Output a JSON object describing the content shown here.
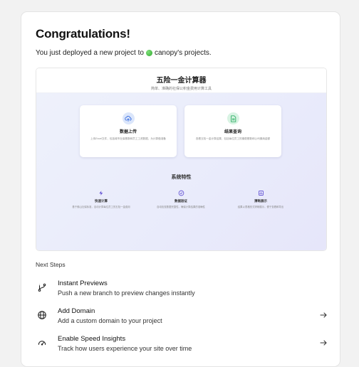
{
  "header": {
    "title": "Congratulations!",
    "subtitle_prefix": "You just deployed a new project to",
    "project_owner": "canopy's projects."
  },
  "preview": {
    "title": "五险一金计算器",
    "subtitle": "简单、准确的社保公积金费用计算工具",
    "features": [
      {
        "icon": "upload-cloud-icon",
        "title": "数据上传",
        "desc": "上传Excel文件，包括城市社保基数和员工工资数据，为计算做准备"
      },
      {
        "icon": "file-document-icon",
        "title": "结果查询",
        "desc": "查看五险一金计算结果，包括每位员工的缴费基数和公司缴纳金额"
      }
    ],
    "section_title": "系统特性",
    "traits": [
      {
        "icon": "lightning-icon",
        "title": "快速计算",
        "desc": "基于佛山社保标准，自动计算每位员工的五险一金费用"
      },
      {
        "icon": "check-circle-icon",
        "title": "数据验证",
        "desc": "自动检查数据完整性，确保计算结果的准确性"
      },
      {
        "icon": "chart-icon",
        "title": "清晰展示",
        "desc": "结果以表格形式清晰展示，便于查看和导出"
      }
    ]
  },
  "next_steps": {
    "label": "Next Steps",
    "items": [
      {
        "icon": "branch-icon",
        "title": "Instant Previews",
        "desc": "Push a new branch to preview changes instantly",
        "has_arrow": false
      },
      {
        "icon": "globe-icon",
        "title": "Add Domain",
        "desc": "Add a custom domain to your project",
        "has_arrow": true
      },
      {
        "icon": "speed-gauge-icon",
        "title": "Enable Speed Insights",
        "desc": "Track how users experience your site over time",
        "has_arrow": true
      }
    ]
  },
  "colors": {
    "accent_blue": "#3b6fe0",
    "accent_green": "#2fb066",
    "accent_purple": "#6b5bd6"
  }
}
